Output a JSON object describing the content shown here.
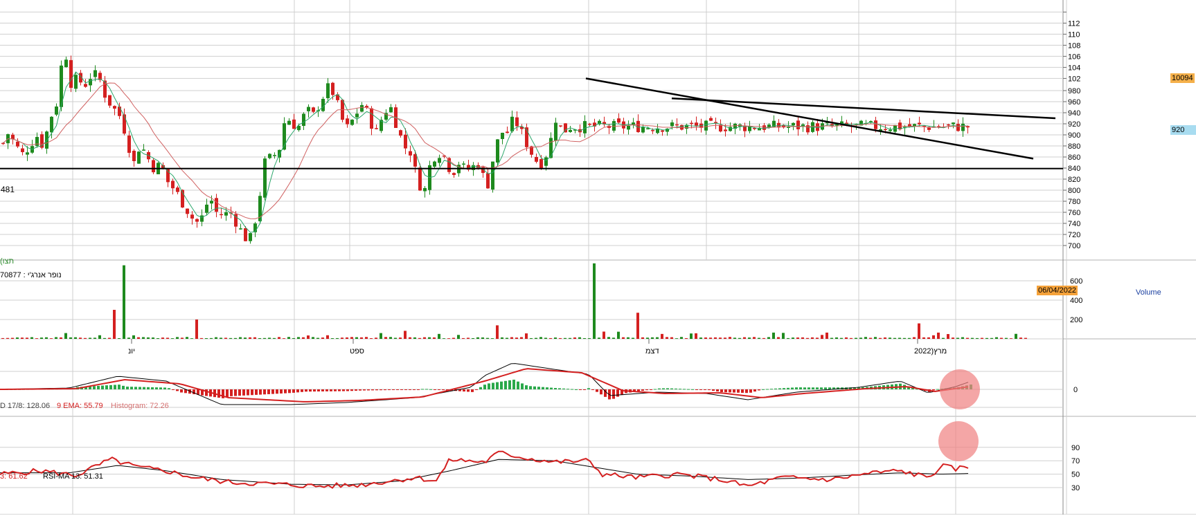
{
  "security": {
    "name": "נופר אנרג'י",
    "value_label": "70877",
    "separator": " : ",
    "caption_partial": "(תצו"
  },
  "price_axis": {
    "ticks": [
      700,
      720,
      740,
      760,
      780,
      800,
      820,
      840,
      860,
      880,
      900,
      920,
      940,
      960,
      980,
      1002,
      1022,
      1042,
      1062,
      1082,
      1102,
      1122
    ],
    "tick_labels": [
      "700",
      "720",
      "740",
      "760",
      "780",
      "800",
      "820",
      "840",
      "860",
      "880",
      "900",
      "920",
      "940",
      "960",
      "980",
      "102",
      "104",
      "106",
      "108",
      "110",
      "112"
    ],
    "last_price": "10094",
    "cursor_price": "920",
    "support_label": "481",
    "support_level": 839
  },
  "volume_panel": {
    "title": "Volume",
    "date_badge": "06/04/2022",
    "ticks": [
      "200",
      "400",
      "600"
    ]
  },
  "macd_panel": {
    "label_macd": "D 17/8: 128.06",
    "label_ema": "9 EMA: 55.79",
    "label_hist": "Histogram: 72.26",
    "ticks": [
      "0"
    ]
  },
  "rsi_panel": {
    "label_rsi": "3: 61.62",
    "label_ma": "RSI-MA 13: 51.31",
    "ticks": [
      "30",
      "50",
      "70",
      "90"
    ]
  },
  "time_axis": {
    "labels": [
      "יונ",
      "ספט",
      "דצמ",
      "מרץ(2022"
    ]
  },
  "colors": {
    "up": "#1e8a1e",
    "down": "#d42020",
    "ma_fast": "#2aa66a",
    "ma_slow": "#d06060",
    "grid": "#cfcfcf",
    "last_price_bg": "#f5b04a",
    "cursor_bg": "#a8dcf0",
    "date_bg": "#f5a23a",
    "highlight": "#f08080"
  },
  "chart_data": {
    "type": "candlestick",
    "price_anchors": [
      [
        0,
        880
      ],
      [
        10,
        905
      ],
      [
        20,
        880
      ],
      [
        30,
        865
      ],
      [
        40,
        880
      ],
      [
        50,
        900
      ],
      [
        60,
        880
      ],
      [
        70,
        930
      ],
      [
        80,
        960
      ],
      [
        90,
        1065
      ],
      [
        100,
        995
      ],
      [
        110,
        1000
      ],
      [
        120,
        990
      ],
      [
        130,
        1010
      ],
      [
        140,
        1005
      ],
      [
        150,
        970
      ],
      [
        160,
        950
      ],
      [
        170,
        935
      ],
      [
        180,
        900
      ],
      [
        190,
        845
      ],
      [
        200,
        885
      ],
      [
        210,
        860
      ],
      [
        220,
        840
      ],
      [
        230,
        845
      ],
      [
        240,
        815
      ],
      [
        250,
        800
      ],
      [
        260,
        780
      ],
      [
        270,
        760
      ],
      [
        280,
        740
      ],
      [
        290,
        752
      ],
      [
        300,
        790
      ],
      [
        310,
        760
      ],
      [
        320,
        755
      ],
      [
        330,
        760
      ],
      [
        340,
        740
      ],
      [
        350,
        715
      ],
      [
        360,
        712
      ],
      [
        370,
        770
      ],
      [
        380,
        850
      ],
      [
        390,
        860
      ],
      [
        400,
        870
      ],
      [
        410,
        935
      ],
      [
        420,
        920
      ],
      [
        430,
        915
      ],
      [
        440,
        945
      ],
      [
        450,
        935
      ],
      [
        460,
        960
      ],
      [
        470,
        985
      ],
      [
        480,
        975
      ],
      [
        490,
        930
      ],
      [
        500,
        910
      ],
      [
        510,
        935
      ],
      [
        520,
        955
      ],
      [
        530,
        935
      ],
      [
        540,
        900
      ],
      [
        550,
        935
      ],
      [
        560,
        955
      ],
      [
        570,
        920
      ],
      [
        580,
        880
      ],
      [
        590,
        870
      ],
      [
        600,
        820
      ],
      [
        610,
        795
      ],
      [
        620,
        855
      ],
      [
        630,
        870
      ],
      [
        640,
        860
      ],
      [
        650,
        830
      ],
      [
        660,
        850
      ],
      [
        670,
        835
      ],
      [
        680,
        842
      ],
      [
        690,
        850
      ],
      [
        700,
        800
      ],
      [
        710,
        860
      ],
      [
        720,
        905
      ],
      [
        730,
        905
      ],
      [
        740,
        930
      ],
      [
        750,
        905
      ],
      [
        760,
        880
      ],
      [
        770,
        855
      ],
      [
        780,
        850
      ],
      [
        790,
        875
      ],
      [
        800,
        930
      ],
      [
        810,
        905
      ],
      [
        820,
        915
      ]
    ],
    "volume_anchors": [
      [
        0,
        8
      ],
      [
        95,
        60
      ],
      [
        160,
        300
      ],
      [
        175,
        760
      ],
      [
        280,
        200
      ],
      [
        715,
        140
      ],
      [
        854,
        780
      ],
      [
        916,
        270
      ],
      [
        1323,
        160
      ]
    ],
    "macd": [
      [
        0,
        0
      ],
      [
        100,
        10
      ],
      [
        170,
        95
      ],
      [
        240,
        60
      ],
      [
        320,
        -110
      ],
      [
        420,
        -110
      ],
      [
        500,
        -95
      ],
      [
        600,
        -60
      ],
      [
        680,
        15
      ],
      [
        700,
        100
      ],
      [
        740,
        190
      ],
      [
        800,
        145
      ],
      [
        850,
        110
      ],
      [
        880,
        -45
      ],
      [
        950,
        -20
      ],
      [
        1020,
        -30
      ],
      [
        1080,
        -75
      ],
      [
        1150,
        -20
      ],
      [
        1240,
        15
      ],
      [
        1300,
        60
      ],
      [
        1340,
        -25
      ],
      [
        1380,
        20
      ],
      [
        1400,
        55
      ]
    ],
    "macd_signal": [
      [
        0,
        0
      ],
      [
        110,
        5
      ],
      [
        180,
        70
      ],
      [
        260,
        40
      ],
      [
        330,
        -60
      ],
      [
        440,
        -90
      ],
      [
        520,
        -80
      ],
      [
        610,
        -55
      ],
      [
        700,
        60
      ],
      [
        760,
        150
      ],
      [
        840,
        120
      ],
      [
        900,
        -10
      ],
      [
        960,
        -30
      ],
      [
        1040,
        -25
      ],
      [
        1100,
        -60
      ],
      [
        1160,
        -30
      ],
      [
        1250,
        5
      ],
      [
        1310,
        20
      ],
      [
        1350,
        -15
      ],
      [
        1400,
        20
      ]
    ],
    "rsi": [
      [
        0,
        50
      ],
      [
        60,
        55
      ],
      [
        110,
        48
      ],
      [
        160,
        72
      ],
      [
        200,
        60
      ],
      [
        240,
        55
      ],
      [
        280,
        45
      ],
      [
        330,
        38
      ],
      [
        400,
        35
      ],
      [
        460,
        32
      ],
      [
        520,
        34
      ],
      [
        600,
        45
      ],
      [
        630,
        40
      ],
      [
        650,
        72
      ],
      [
        700,
        68
      ],
      [
        720,
        82
      ],
      [
        760,
        74
      ],
      [
        800,
        68
      ],
      [
        850,
        70
      ],
      [
        870,
        50
      ],
      [
        920,
        45
      ],
      [
        980,
        50
      ],
      [
        1040,
        42
      ],
      [
        1080,
        32
      ],
      [
        1130,
        45
      ],
      [
        1200,
        42
      ],
      [
        1260,
        52
      ],
      [
        1300,
        55
      ],
      [
        1340,
        45
      ],
      [
        1360,
        62
      ],
      [
        1380,
        58
      ],
      [
        1400,
        61
      ]
    ],
    "rsi_ma": [
      [
        0,
        52
      ],
      [
        100,
        52
      ],
      [
        170,
        63
      ],
      [
        240,
        55
      ],
      [
        320,
        42
      ],
      [
        420,
        35
      ],
      [
        500,
        34
      ],
      [
        580,
        40
      ],
      [
        650,
        55
      ],
      [
        720,
        72
      ],
      [
        800,
        70
      ],
      [
        860,
        60
      ],
      [
        920,
        50
      ],
      [
        1000,
        47
      ],
      [
        1080,
        42
      ],
      [
        1150,
        44
      ],
      [
        1240,
        49
      ],
      [
        1300,
        52
      ],
      [
        1360,
        50
      ],
      [
        1400,
        51
      ]
    ],
    "trendlines": [
      {
        "from": [
          846,
          1002
        ],
        "to": [
          1492,
          857
        ]
      },
      {
        "from": [
          970,
          966
        ],
        "to": [
          1524,
          930
        ]
      }
    ]
  }
}
